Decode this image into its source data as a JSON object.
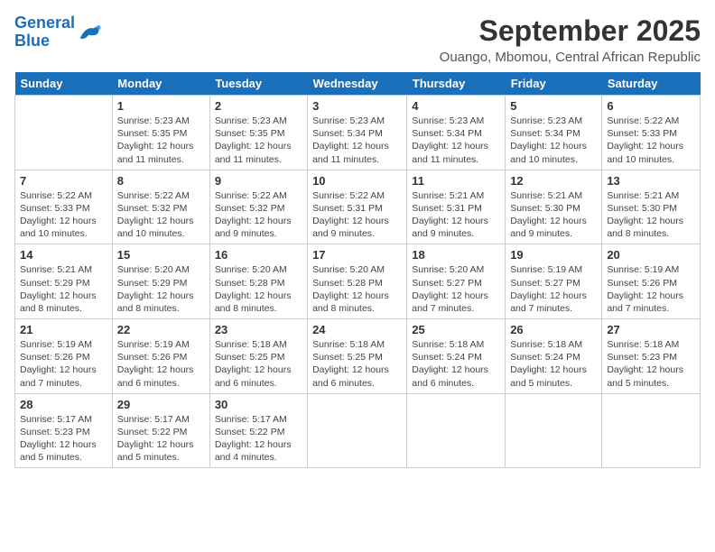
{
  "header": {
    "logo_line1": "General",
    "logo_line2": "Blue",
    "month": "September 2025",
    "location": "Ouango, Mbomou, Central African Republic"
  },
  "days_of_week": [
    "Sunday",
    "Monday",
    "Tuesday",
    "Wednesday",
    "Thursday",
    "Friday",
    "Saturday"
  ],
  "weeks": [
    [
      {
        "date": "",
        "text": ""
      },
      {
        "date": "1",
        "text": "Sunrise: 5:23 AM\nSunset: 5:35 PM\nDaylight: 12 hours\nand 11 minutes."
      },
      {
        "date": "2",
        "text": "Sunrise: 5:23 AM\nSunset: 5:35 PM\nDaylight: 12 hours\nand 11 minutes."
      },
      {
        "date": "3",
        "text": "Sunrise: 5:23 AM\nSunset: 5:34 PM\nDaylight: 12 hours\nand 11 minutes."
      },
      {
        "date": "4",
        "text": "Sunrise: 5:23 AM\nSunset: 5:34 PM\nDaylight: 12 hours\nand 11 minutes."
      },
      {
        "date": "5",
        "text": "Sunrise: 5:23 AM\nSunset: 5:34 PM\nDaylight: 12 hours\nand 10 minutes."
      },
      {
        "date": "6",
        "text": "Sunrise: 5:22 AM\nSunset: 5:33 PM\nDaylight: 12 hours\nand 10 minutes."
      }
    ],
    [
      {
        "date": "7",
        "text": "Sunrise: 5:22 AM\nSunset: 5:33 PM\nDaylight: 12 hours\nand 10 minutes."
      },
      {
        "date": "8",
        "text": "Sunrise: 5:22 AM\nSunset: 5:32 PM\nDaylight: 12 hours\nand 10 minutes."
      },
      {
        "date": "9",
        "text": "Sunrise: 5:22 AM\nSunset: 5:32 PM\nDaylight: 12 hours\nand 9 minutes."
      },
      {
        "date": "10",
        "text": "Sunrise: 5:22 AM\nSunset: 5:31 PM\nDaylight: 12 hours\nand 9 minutes."
      },
      {
        "date": "11",
        "text": "Sunrise: 5:21 AM\nSunset: 5:31 PM\nDaylight: 12 hours\nand 9 minutes."
      },
      {
        "date": "12",
        "text": "Sunrise: 5:21 AM\nSunset: 5:30 PM\nDaylight: 12 hours\nand 9 minutes."
      },
      {
        "date": "13",
        "text": "Sunrise: 5:21 AM\nSunset: 5:30 PM\nDaylight: 12 hours\nand 8 minutes."
      }
    ],
    [
      {
        "date": "14",
        "text": "Sunrise: 5:21 AM\nSunset: 5:29 PM\nDaylight: 12 hours\nand 8 minutes."
      },
      {
        "date": "15",
        "text": "Sunrise: 5:20 AM\nSunset: 5:29 PM\nDaylight: 12 hours\nand 8 minutes."
      },
      {
        "date": "16",
        "text": "Sunrise: 5:20 AM\nSunset: 5:28 PM\nDaylight: 12 hours\nand 8 minutes."
      },
      {
        "date": "17",
        "text": "Sunrise: 5:20 AM\nSunset: 5:28 PM\nDaylight: 12 hours\nand 8 minutes."
      },
      {
        "date": "18",
        "text": "Sunrise: 5:20 AM\nSunset: 5:27 PM\nDaylight: 12 hours\nand 7 minutes."
      },
      {
        "date": "19",
        "text": "Sunrise: 5:19 AM\nSunset: 5:27 PM\nDaylight: 12 hours\nand 7 minutes."
      },
      {
        "date": "20",
        "text": "Sunrise: 5:19 AM\nSunset: 5:26 PM\nDaylight: 12 hours\nand 7 minutes."
      }
    ],
    [
      {
        "date": "21",
        "text": "Sunrise: 5:19 AM\nSunset: 5:26 PM\nDaylight: 12 hours\nand 7 minutes."
      },
      {
        "date": "22",
        "text": "Sunrise: 5:19 AM\nSunset: 5:26 PM\nDaylight: 12 hours\nand 6 minutes."
      },
      {
        "date": "23",
        "text": "Sunrise: 5:18 AM\nSunset: 5:25 PM\nDaylight: 12 hours\nand 6 minutes."
      },
      {
        "date": "24",
        "text": "Sunrise: 5:18 AM\nSunset: 5:25 PM\nDaylight: 12 hours\nand 6 minutes."
      },
      {
        "date": "25",
        "text": "Sunrise: 5:18 AM\nSunset: 5:24 PM\nDaylight: 12 hours\nand 6 minutes."
      },
      {
        "date": "26",
        "text": "Sunrise: 5:18 AM\nSunset: 5:24 PM\nDaylight: 12 hours\nand 5 minutes."
      },
      {
        "date": "27",
        "text": "Sunrise: 5:18 AM\nSunset: 5:23 PM\nDaylight: 12 hours\nand 5 minutes."
      }
    ],
    [
      {
        "date": "28",
        "text": "Sunrise: 5:17 AM\nSunset: 5:23 PM\nDaylight: 12 hours\nand 5 minutes."
      },
      {
        "date": "29",
        "text": "Sunrise: 5:17 AM\nSunset: 5:22 PM\nDaylight: 12 hours\nand 5 minutes."
      },
      {
        "date": "30",
        "text": "Sunrise: 5:17 AM\nSunset: 5:22 PM\nDaylight: 12 hours\nand 4 minutes."
      },
      {
        "date": "",
        "text": ""
      },
      {
        "date": "",
        "text": ""
      },
      {
        "date": "",
        "text": ""
      },
      {
        "date": "",
        "text": ""
      }
    ]
  ]
}
